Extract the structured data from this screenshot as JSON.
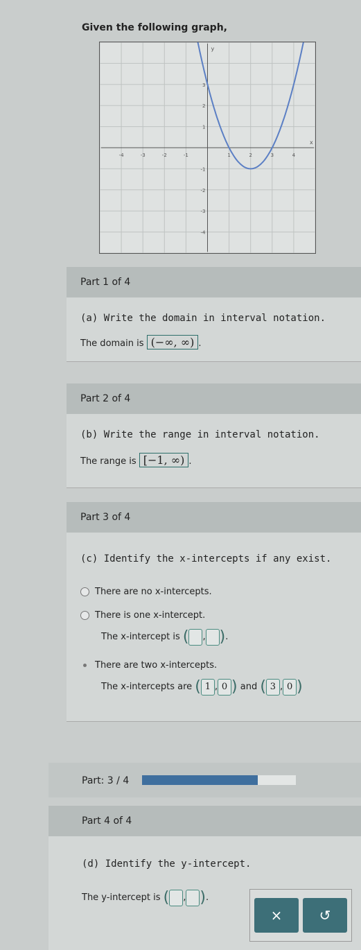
{
  "prompt": "Given the following graph,",
  "chart_data": {
    "type": "line",
    "xlim": [
      -5,
      5
    ],
    "ylim": [
      -5,
      5
    ],
    "grid": true,
    "x_ticks": [
      -4,
      -3,
      -2,
      -1,
      1,
      2,
      3,
      4
    ],
    "y_ticks": [
      -4,
      -3,
      -2,
      -1,
      1,
      2,
      3
    ],
    "xlabel": "x",
    "ylabel": "y",
    "function": "y = x^2 - 4x + 3",
    "vertex": [
      2,
      -1
    ],
    "x_intercepts": [
      1,
      3
    ],
    "y_intercept": 3,
    "color": "#5b7fc4"
  },
  "part1": {
    "header": "Part 1 of 4",
    "question": "(a) Write the domain in interval notation.",
    "label": "The domain is",
    "answer": "(−∞, ∞)"
  },
  "part2": {
    "header": "Part 2 of 4",
    "question": "(b) Write the range in interval notation.",
    "label": "The range is",
    "answer": "[−1, ∞)"
  },
  "part3": {
    "header": "Part 3 of 4",
    "question": "(c) Identify the x-intercepts if any exist.",
    "opt_none": "There are no x-intercepts.",
    "opt_one": "There is one x-intercept.",
    "one_label": "The x-intercept is",
    "opt_two": "There are two x-intercepts.",
    "two_label": "The x-intercepts are",
    "and": "and",
    "p1x": "1",
    "p1y": "0",
    "p2x": "3",
    "p2y": "0"
  },
  "progress": {
    "label": "Part: 3 / 4",
    "value": 0.75,
    "color": "#3f6f9e"
  },
  "part4": {
    "header": "Part 4 of 4",
    "question": "(d) Identify the y-intercept.",
    "label": "The y-intercept is"
  },
  "buttons": {
    "clear": "×",
    "undo": "↺"
  }
}
